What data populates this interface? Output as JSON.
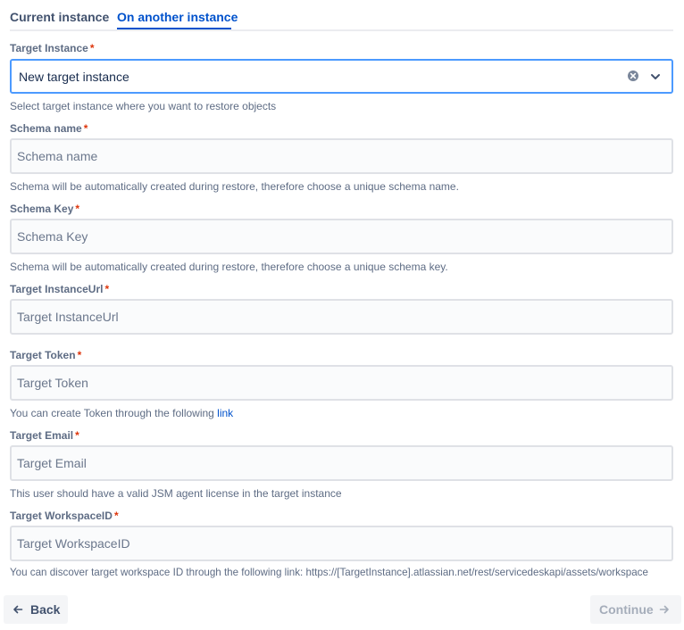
{
  "tabs": {
    "current": "Current instance",
    "another": "On another instance"
  },
  "target_instance": {
    "label": "Target Instance",
    "value": "New target instance",
    "help": "Select target instance where you want to restore objects"
  },
  "schema_name": {
    "label": "Schema name",
    "placeholder": "Schema name",
    "help": "Schema will be automatically created during restore, therefore choose a unique schema name."
  },
  "schema_key": {
    "label": "Schema Key",
    "placeholder": "Schema Key",
    "help": "Schema will be automatically created during restore, therefore choose a unique schema key."
  },
  "instance_url": {
    "label": "Target InstanceUrl",
    "placeholder": "Target InstanceUrl"
  },
  "token": {
    "label": "Target Token",
    "placeholder": "Target Token",
    "help_prefix": "You can create Token through the following ",
    "help_link": "link"
  },
  "email": {
    "label": "Target Email",
    "placeholder": "Target Email",
    "help": "This user should have a valid JSM agent license in the target instance"
  },
  "workspace": {
    "label": "Target WorkspaceID",
    "placeholder": "Target WorkspaceID",
    "help": "You can discover target workspace ID through the following link: https://[TargetInstance].atlassian.net/rest/servicedeskapi/assets/workspace"
  },
  "required_marker": "*",
  "footer": {
    "back_label": "Back",
    "continue_label": "Continue"
  },
  "colors": {
    "accent": "#0052cc",
    "focus_border": "#4c9aff",
    "required": "#de350b"
  },
  "icons": {
    "clear": "clear-icon",
    "chevron": "chevron-down-icon",
    "back": "arrow-left-icon",
    "continue": "arrow-right-icon"
  }
}
